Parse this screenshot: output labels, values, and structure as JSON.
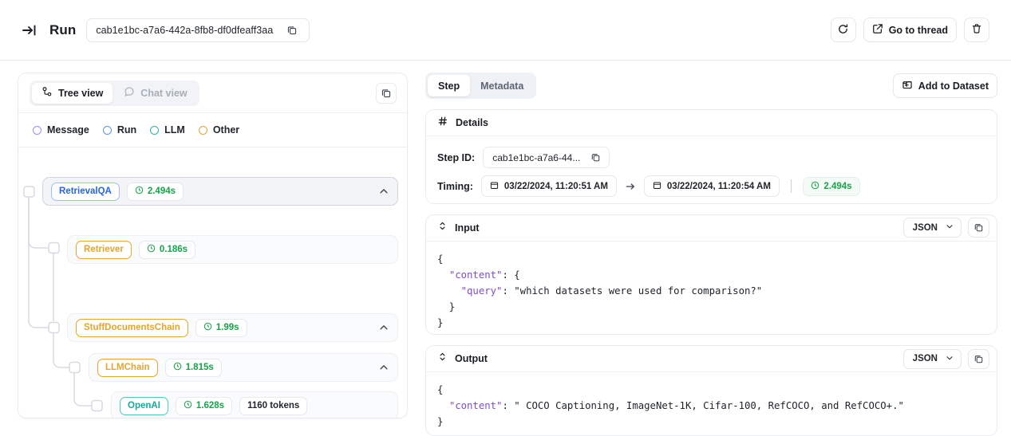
{
  "topbar": {
    "collapse_icon": "collapse-panel-icon",
    "title": "Run",
    "run_id": "cab1e1bc-a7a6-442a-8fb8-df0dfeaff3aa",
    "copy_icon": "copy-icon",
    "refresh_label": "refresh-icon",
    "go_to_thread_label": "Go to thread",
    "delete_label": "trash-icon"
  },
  "left_panel": {
    "tabs": [
      {
        "label": "Tree view",
        "icon": "tree-icon",
        "active": true
      },
      {
        "label": "Chat view",
        "icon": "chat-bubble-icon",
        "active": false
      }
    ],
    "expand_icon": "copy-icon",
    "legend": [
      {
        "label": "Message",
        "color": "#9b8afb"
      },
      {
        "label": "Run",
        "color": "#5b93f0"
      },
      {
        "label": "LLM",
        "color": "#2bb6a4"
      },
      {
        "label": "Other",
        "color": "#e5a52e"
      }
    ],
    "tree": [
      {
        "name": "RetrievalQA",
        "type": "run",
        "color": "#2563eb",
        "border": "#9cc0f5",
        "duration": "2.494s",
        "tokens": "",
        "depth": 0,
        "selected": true,
        "expandable": true
      },
      {
        "name": "Retriever",
        "type": "other",
        "color": "#e5a52e",
        "border": "#e5a52e",
        "duration": "0.186s",
        "tokens": "",
        "depth": 1,
        "selected": false,
        "expandable": false
      },
      {
        "name": "StuffDocumentsChain",
        "type": "other",
        "color": "#e5a52e",
        "border": "#e5a52e",
        "duration": "1.99s",
        "tokens": "",
        "depth": 1,
        "selected": false,
        "expandable": true
      },
      {
        "name": "LLMChain",
        "type": "other",
        "color": "#e5a52e",
        "border": "#e5a52e",
        "duration": "1.815s",
        "tokens": "",
        "depth": 2,
        "selected": false,
        "expandable": true
      },
      {
        "name": "OpenAI",
        "type": "llm",
        "color": "#1aa897",
        "border": "#4fc9ba",
        "duration": "1.628s",
        "tokens": "1160 tokens",
        "depth": 3,
        "selected": false,
        "expandable": false
      }
    ]
  },
  "right_panel": {
    "tabs": [
      {
        "label": "Step",
        "active": true
      },
      {
        "label": "Metadata",
        "active": false
      }
    ],
    "add_to_dataset_label": "Add to Dataset",
    "add_to_dataset_icon": "add-to-dataset-icon",
    "details": {
      "title": "Details",
      "title_icon": "hash-icon",
      "step_id_label": "Step ID:",
      "step_id_value": "cab1e1bc-a7a6-44...",
      "copy_icon": "copy-icon",
      "timing_label": "Timing:",
      "start_time": "03/22/2024, 11:20:51 AM",
      "end_time": "03/22/2024, 11:20:54 AM",
      "duration": "2.494s",
      "calendar_icon": "calendar-icon",
      "clock_icon": "clock-icon",
      "arrow_icon": "arrow-right-icon"
    },
    "input": {
      "title": "Input",
      "toggle_icon": "collapse-toggle-icon",
      "format": "JSON",
      "chevron_icon": "chevron-down-icon",
      "copy_icon": "copy-icon",
      "lines": [
        [
          {
            "t": "{",
            "c": "p"
          }
        ],
        [
          {
            "t": "  ",
            "c": "p"
          },
          {
            "t": "\"content\"",
            "c": "k"
          },
          {
            "t": ": {",
            "c": "p"
          }
        ],
        [
          {
            "t": "    ",
            "c": "p"
          },
          {
            "t": "\"query\"",
            "c": "k"
          },
          {
            "t": ": \"which datasets were used for comparison?\"",
            "c": "p"
          }
        ],
        [
          {
            "t": "  }",
            "c": "p"
          }
        ],
        [
          {
            "t": "}",
            "c": "p"
          }
        ]
      ]
    },
    "output": {
      "title": "Output",
      "toggle_icon": "collapse-toggle-icon",
      "format": "JSON",
      "chevron_icon": "chevron-down-icon",
      "copy_icon": "copy-icon",
      "lines": [
        [
          {
            "t": "{",
            "c": "p"
          }
        ],
        [
          {
            "t": "  ",
            "c": "p"
          },
          {
            "t": "\"content\"",
            "c": "k"
          },
          {
            "t": ": \" COCO Captioning, ImageNet-1K, Cifar-100, RefCOCO, and RefCOCO+.\"",
            "c": "p"
          }
        ],
        [
          {
            "t": "}",
            "c": "p"
          }
        ]
      ]
    }
  }
}
